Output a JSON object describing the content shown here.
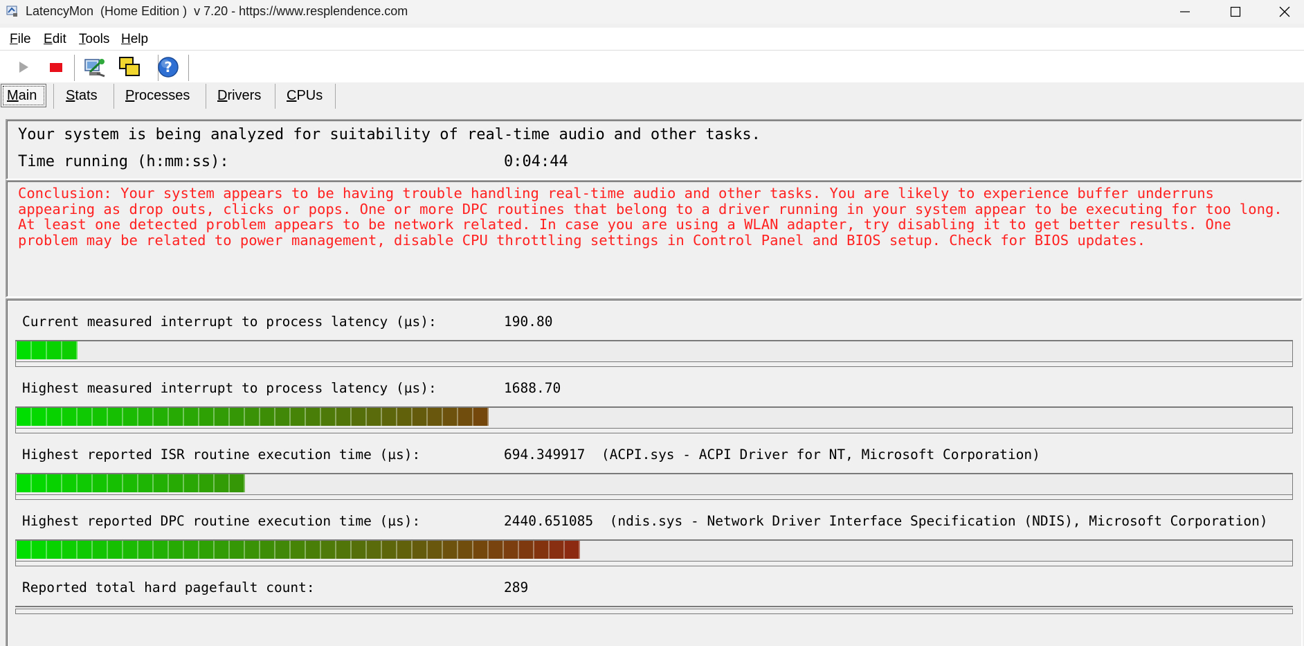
{
  "window": {
    "title": "LatencyMon  (Home Edition )  v 7.20 - https://www.resplendence.com"
  },
  "menu": {
    "items": [
      {
        "accel": "F",
        "rest": "ile"
      },
      {
        "accel": "E",
        "rest": "dit"
      },
      {
        "accel": "T",
        "rest": "ools"
      },
      {
        "accel": "H",
        "rest": "elp"
      }
    ]
  },
  "toolbar": {
    "buttons": [
      "play-icon",
      "stop-icon",
      "analyze-icon",
      "windows-icon",
      "help-icon"
    ]
  },
  "tabs": [
    {
      "accel": "M",
      "rest": "ain",
      "active": true
    },
    {
      "accel": "S",
      "rest": "tats"
    },
    {
      "accel": "P",
      "rest": "rocesses"
    },
    {
      "accel": "D",
      "rest": "rivers"
    },
    {
      "accel": "C",
      "rest": "PUs"
    }
  ],
  "status": {
    "analyzing_text": "Your system is being analyzed for suitability of real-time audio and other tasks.",
    "time_running_label": "Time running (h:mm:ss):",
    "time_running_value": "0:04:44"
  },
  "conclusion": {
    "text": "Conclusion: Your system appears to be having trouble handling real-time audio and other tasks. You are likely to experience buffer underruns appearing as drop outs, clicks or pops. One or more DPC routines that belong to a driver running in your system appear to be executing for too long. At least one detected problem appears to be network related. In case you are using a WLAN adapter, try disabling it to get better results. One problem may be related to power management, disable CPU throttling settings in Control Panel and BIOS setup. Check for BIOS updates.",
    "color": "#ff2020"
  },
  "metrics": [
    {
      "label": "Current measured interrupt to process latency (µs):",
      "value": "190.80",
      "detail": "",
      "segments": 4
    },
    {
      "label": "Highest measured interrupt to process latency (µs):",
      "value": "1688.70",
      "detail": "",
      "segments": 31
    },
    {
      "label": "Highest reported ISR routine execution time (µs):",
      "value": "694.349917",
      "detail": "(ACPI.sys - ACPI Driver for NT, Microsoft Corporation)",
      "segments": 15
    },
    {
      "label": "Highest reported DPC routine execution time (µs):",
      "value": "2440.651085",
      "detail": "(ndis.sys - Network Driver Interface Specification (NDIS), Microsoft Corporation)",
      "segments": 37
    },
    {
      "label": "Reported total hard pagefault count:",
      "value": "289",
      "detail": "",
      "segments": 0
    }
  ],
  "colors": {
    "meter_start": "#00dd00",
    "meter_end": "#8b2a10"
  }
}
